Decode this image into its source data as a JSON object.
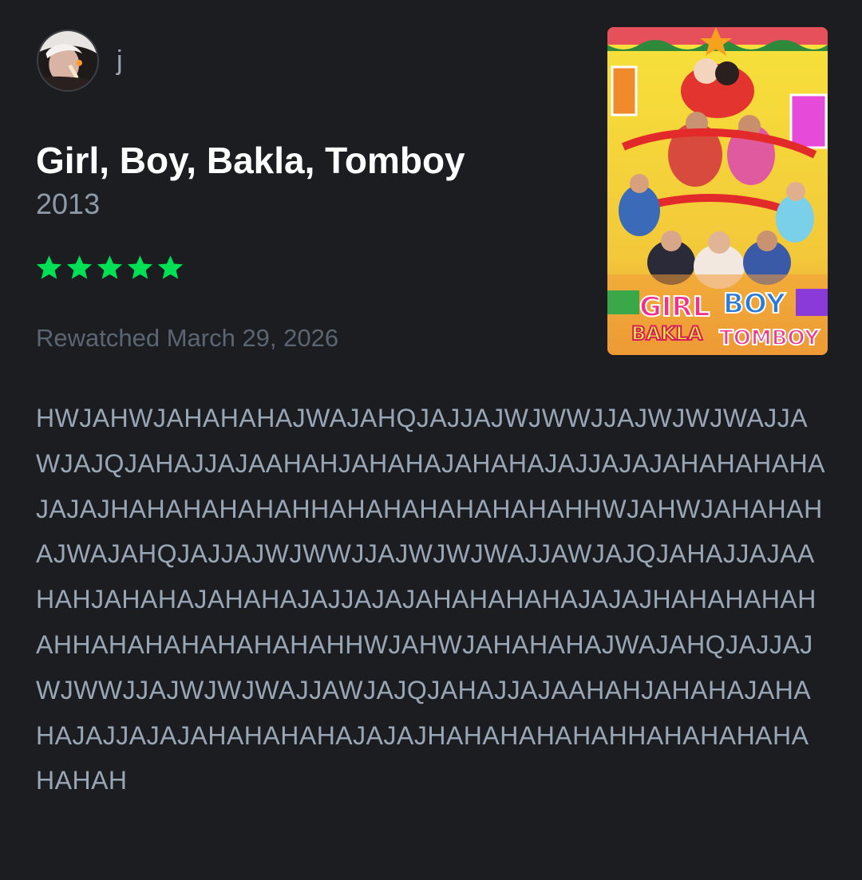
{
  "user": {
    "username": "j",
    "avatar_icon": "user-avatar-photo"
  },
  "film": {
    "title": "Girl, Boy, Bakla, Tomboy",
    "year": "2013",
    "poster_icon": "film-poster",
    "poster_logo_text": [
      "GIRL",
      "BOY",
      "BAKLA",
      "TOMBOY"
    ]
  },
  "rating": {
    "stars": 5,
    "max": 5,
    "color": "#00e054"
  },
  "entry": {
    "watch_label": "Rewatched March 29, 2026"
  },
  "review": {
    "text": "HWJAHWJAHAHAHAJWAJAHQJAJJAJWJWWJJAJWJWJWAJJAWJAJQJAHAJJAJAAHAHJAHAHAJAHAHAJAJJAJAJAHAHAHAHAJAJAJHAHAHAHAHAHHAHAHAHAHAHAHAHHWJAHWJAHAHAHAJWAJAHQJAJJAJWJWWJJAJWJWJWAJJAWJAJQJAHAJJAJAAHAHJAHAHAJAHAHAJAJJAJAJAHAHAHAHAJAJAJHAHAHAHAHAHHAHAHAHAHAHAHAHHWJAHWJAHAHAHAJWAJAHQJAJJAJWJWWJJAJWJWJWAJJAWJAJQJAHAJJAJAAHAHJAHAHAJAHAHAJAJJAJAJAHAHAHAHAJAJAJHAHAHAHAHAHHAHAHAHAHAHAHAH"
  },
  "colors": {
    "background": "#1b1d21",
    "title": "#ffffff",
    "body_text": "#99a6b5",
    "muted_text": "#5c6673"
  }
}
